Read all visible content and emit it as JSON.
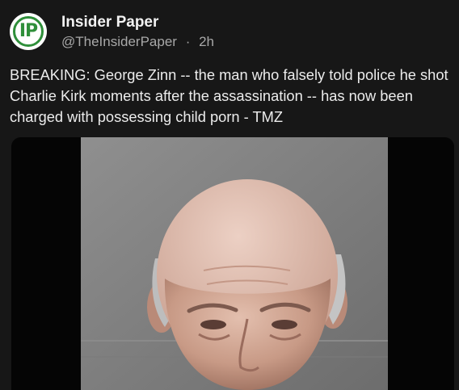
{
  "post": {
    "author": {
      "avatar_text": "IP",
      "display_name": "Insider Paper",
      "handle": "@TheInsiderPaper",
      "separator": "·",
      "time": "2h"
    },
    "text": "BREAKING: George Zinn -- the man who falsely told police he shot Charlie Kirk moments after the assassination -- has now been charged with possessing child porn - TMZ",
    "media": {
      "type": "photo",
      "description_icon": "mugshot-photo"
    }
  },
  "colors": {
    "background": "#171717",
    "text": "#ececec",
    "muted": "#a8a8a8",
    "avatar_brand": "#2f8f3a"
  }
}
